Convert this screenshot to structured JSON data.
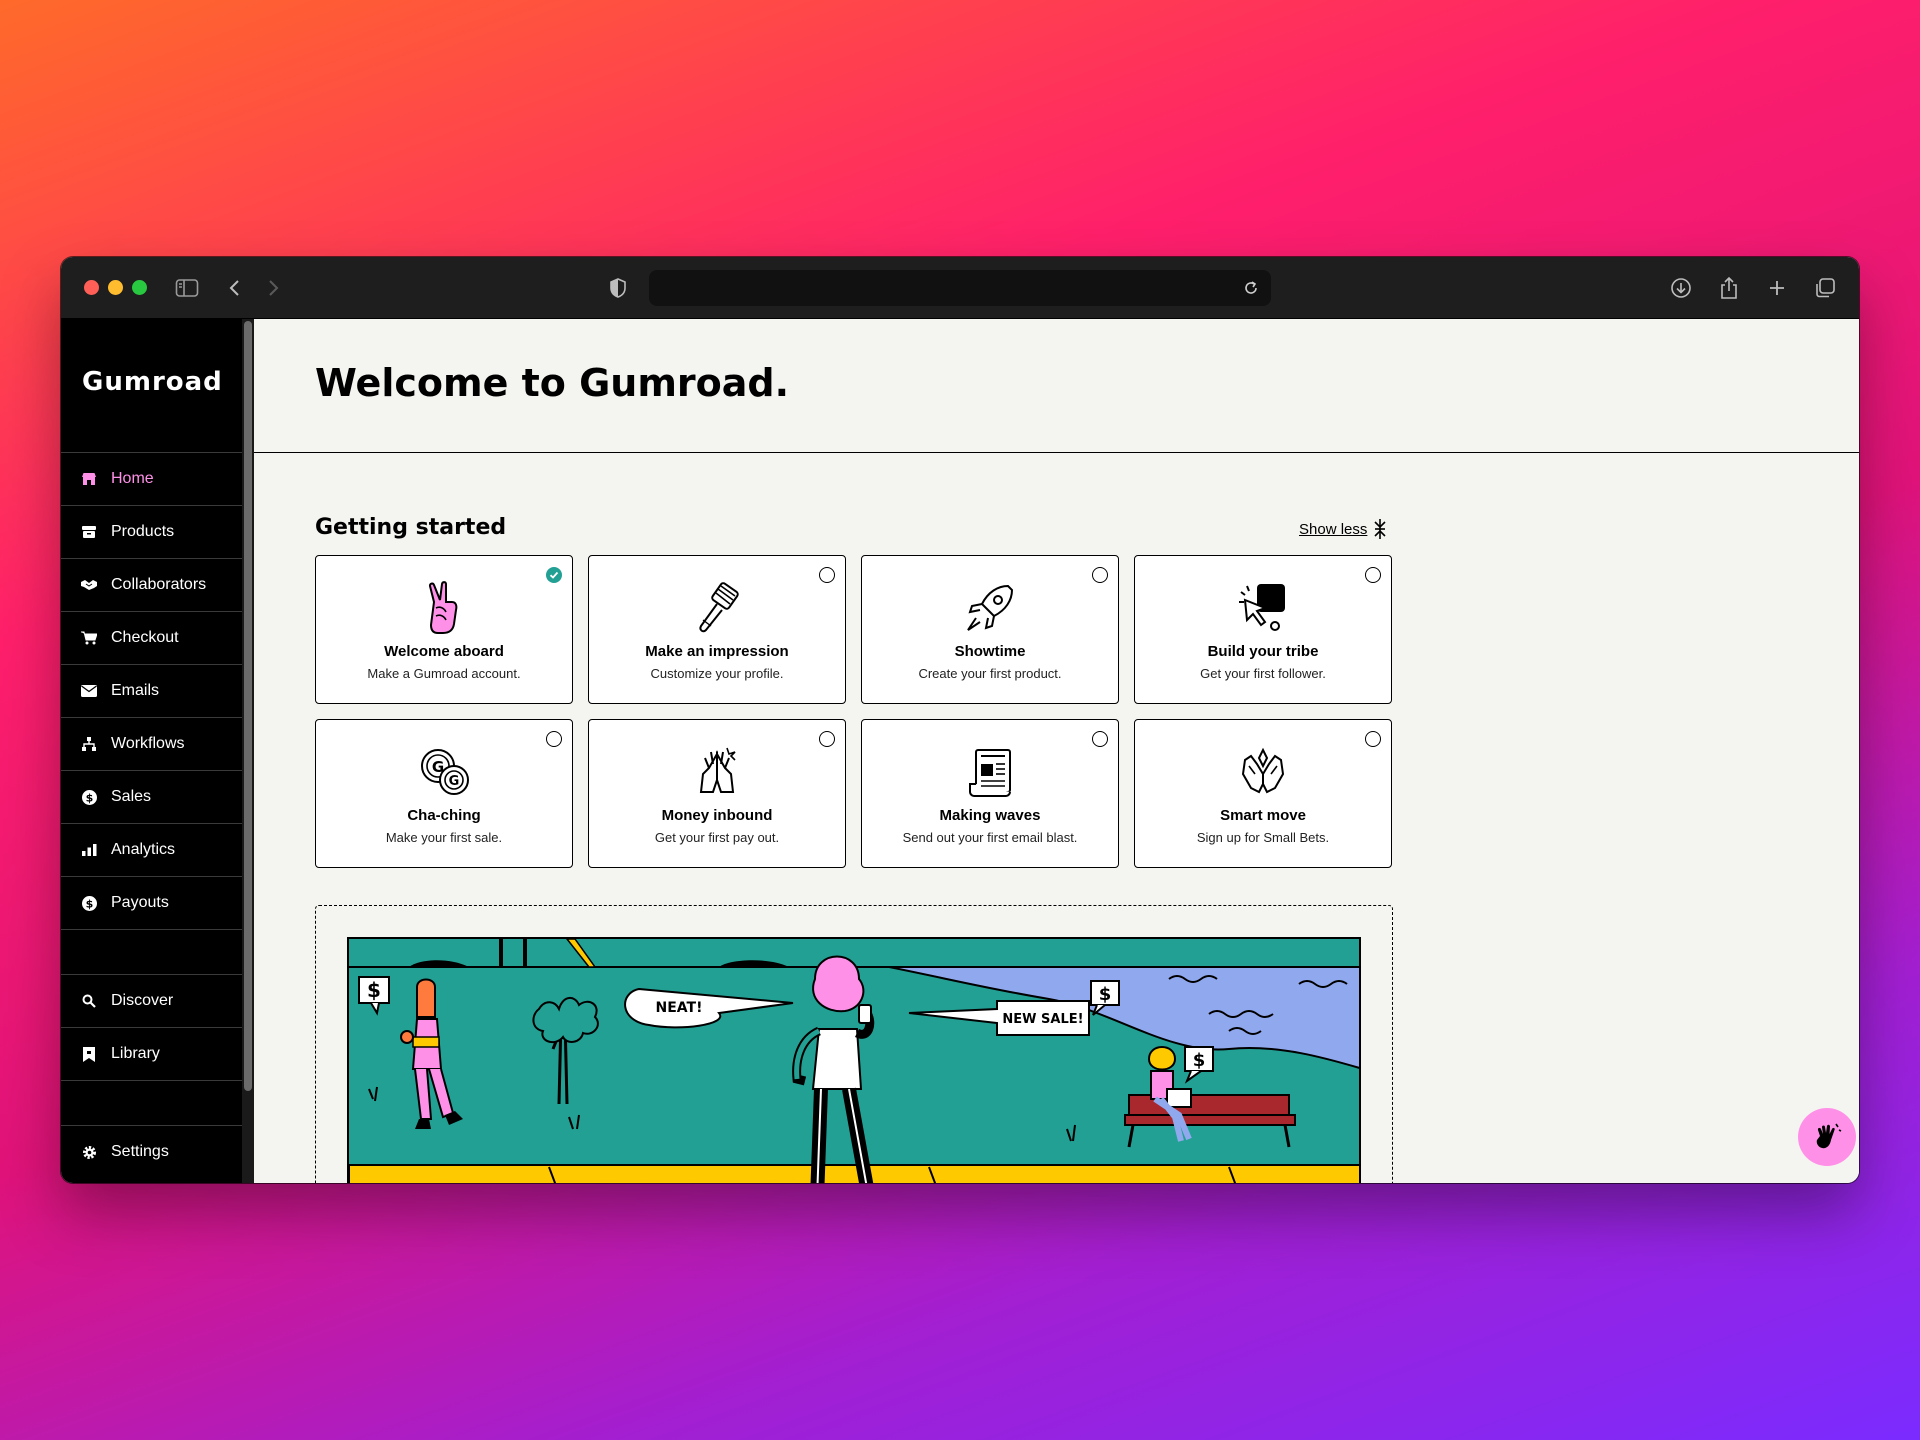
{
  "browser": {
    "url": "",
    "icons": [
      "sidebar-toggle-icon",
      "back-icon",
      "forward-icon",
      "shield-icon",
      "reload-icon",
      "download-icon",
      "share-icon",
      "new-tab-icon",
      "tabs-overview-icon"
    ]
  },
  "sidebar": {
    "logo": "Gumroad",
    "items": [
      {
        "label": "Home",
        "icon": "home-icon",
        "active": true
      },
      {
        "label": "Products",
        "icon": "archive-icon"
      },
      {
        "label": "Collaborators",
        "icon": "handshake-icon"
      },
      {
        "label": "Checkout",
        "icon": "cart-icon"
      },
      {
        "label": "Emails",
        "icon": "envelope-icon"
      },
      {
        "label": "Workflows",
        "icon": "workflow-icon"
      },
      {
        "label": "Sales",
        "icon": "dollar-circle-icon"
      },
      {
        "label": "Analytics",
        "icon": "bar-chart-icon"
      },
      {
        "label": "Payouts",
        "icon": "dollar-circle-icon"
      }
    ],
    "secondary": [
      {
        "label": "Discover",
        "icon": "search-icon"
      },
      {
        "label": "Library",
        "icon": "bookmark-icon"
      }
    ],
    "settings": {
      "label": "Settings",
      "icon": "gear-icon"
    }
  },
  "main": {
    "title": "Welcome to Gumroad.",
    "getting_started": {
      "heading": "Getting started",
      "toggle_label": "Show less",
      "cards": [
        {
          "title": "Welcome aboard",
          "desc": "Make a Gumroad account.",
          "done": true,
          "icon": "peace-hand-icon"
        },
        {
          "title": "Make an impression",
          "desc": "Customize your profile.",
          "done": false,
          "icon": "paintbrush-icon"
        },
        {
          "title": "Showtime",
          "desc": "Create your first product.",
          "done": false,
          "icon": "rocket-icon"
        },
        {
          "title": "Build your tribe",
          "desc": "Get your first follower.",
          "done": false,
          "icon": "cursor-click-icon"
        },
        {
          "title": "Cha-ching",
          "desc": "Make your first sale.",
          "done": false,
          "icon": "coins-icon"
        },
        {
          "title": "Money inbound",
          "desc": "Get your first pay out.",
          "done": false,
          "icon": "praying-hands-icon"
        },
        {
          "title": "Making waves",
          "desc": "Send out your first email blast.",
          "done": false,
          "icon": "newspaper-icon"
        },
        {
          "title": "Smart move",
          "desc": "Sign up for Small Bets.",
          "done": false,
          "icon": "open-hands-icon"
        }
      ]
    },
    "illustration": {
      "bubble_left": "NEAT!",
      "bubble_right": "NEW SALE!",
      "dollar": "$"
    }
  },
  "colors": {
    "accent_pink": "#ff90e8",
    "teal": "#23a094",
    "yellow": "#ffc900",
    "sky": "#90a8ed"
  },
  "fab_icon": "waving-hand-icon"
}
